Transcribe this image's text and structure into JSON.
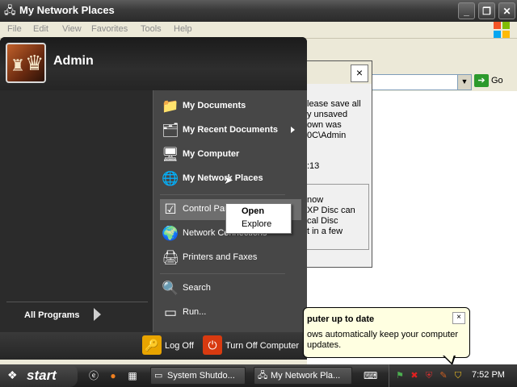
{
  "window": {
    "title": "My Network Places",
    "menu": [
      "File",
      "Edit",
      "View",
      "Favorites",
      "Tools",
      "Help"
    ],
    "address_go": "Go"
  },
  "dialog": {
    "close": "×",
    "lines": [
      "lease save all",
      "y unsaved",
      "own was",
      "0C\\Admin"
    ],
    "time": ":13",
    "box_lines": [
      "now",
      "XP Disc can",
      "cal Disc",
      "t in a few"
    ]
  },
  "start_menu": {
    "username": "Admin",
    "all_programs": "All Programs",
    "right_items": [
      {
        "label": "My Documents",
        "icon": "folder-icon"
      },
      {
        "label": "My Recent Documents",
        "icon": "recent-docs-icon"
      },
      {
        "label": "My Computer",
        "icon": "computer-icon"
      },
      {
        "label": "My Network Places",
        "icon": "network-icon"
      },
      {
        "label": "Control Panel",
        "icon": "control-panel-icon"
      },
      {
        "label": "Network Connections",
        "icon": "network-connections-icon"
      },
      {
        "label": "Printers and Faxes",
        "icon": "printer-icon"
      },
      {
        "label": "Search",
        "icon": "search-icon"
      },
      {
        "label": "Run...",
        "icon": "run-icon"
      }
    ],
    "log_off": "Log Off",
    "turn_off": "Turn Off Computer"
  },
  "context_menu": {
    "open": "Open",
    "explore": "Explore"
  },
  "balloon": {
    "title": "puter up to date",
    "text": "ows automatically keep your computer updates.",
    "close": "×"
  },
  "taskbar": {
    "start": "start",
    "tasks": [
      "System Shutdo...",
      "My Network Pla..."
    ],
    "clock": "7:52 PM"
  },
  "colors": {
    "start_menu_dark": "#2b2b2b",
    "start_menu_right": "#474747",
    "balloon_bg": "#ffffe1",
    "go_green": "#2c9a2c"
  }
}
